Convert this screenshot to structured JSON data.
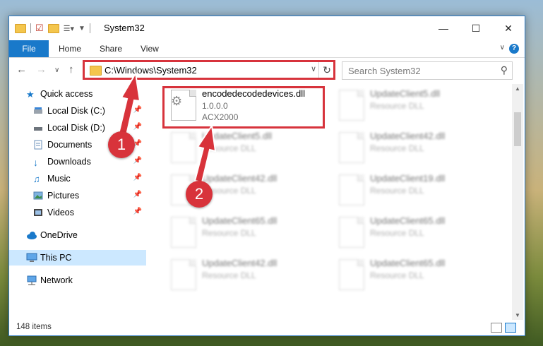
{
  "window": {
    "title": "System32"
  },
  "ribbon": {
    "tabs": [
      "File",
      "Home",
      "Share",
      "View"
    ],
    "help": "?"
  },
  "nav": {
    "address_path": "C:\\Windows\\System32",
    "search_placeholder": "Search System32"
  },
  "sidebar": {
    "items": [
      {
        "label": "Quick access",
        "icon": "star-icon",
        "pinned": false
      },
      {
        "label": "Local Disk (C:)",
        "icon": "drive-icon",
        "pinned": true
      },
      {
        "label": "Local Disk (D:)",
        "icon": "drive-icon",
        "pinned": true
      },
      {
        "label": "Documents",
        "icon": "documents-icon",
        "pinned": true
      },
      {
        "label": "Downloads",
        "icon": "download-icon",
        "pinned": true
      },
      {
        "label": "Music",
        "icon": "music-icon",
        "pinned": true
      },
      {
        "label": "Pictures",
        "icon": "pictures-icon",
        "pinned": true
      },
      {
        "label": "Videos",
        "icon": "videos-icon",
        "pinned": true
      },
      {
        "label": "OneDrive",
        "icon": "cloud-icon",
        "pinned": false
      },
      {
        "label": "This PC",
        "icon": "computer-icon",
        "pinned": false,
        "selected": true
      },
      {
        "label": "Network",
        "icon": "network-icon",
        "pinned": false
      }
    ]
  },
  "files": [
    {
      "name": "encodedecodedevices.dll",
      "line2": "1.0.0.0",
      "line3": "ACX2000",
      "blurred": false
    },
    {
      "name": "UpdateClient5.dll",
      "line2": "Resource DLL",
      "blurred": true
    },
    {
      "name": "UpdateClient5.dll",
      "line2": "Resource DLL",
      "blurred": true
    },
    {
      "name": "UpdateClient42.dll",
      "line2": "Resource DLL",
      "blurred": true
    },
    {
      "name": "UpdateClient42.dll",
      "line2": "Resource DLL",
      "blurred": true
    },
    {
      "name": "UpdateClient19.dll",
      "line2": "Resource DLL",
      "blurred": true
    },
    {
      "name": "UpdateClient65.dll",
      "line2": "Resource DLL",
      "blurred": true
    },
    {
      "name": "UpdateClient65.dll",
      "line2": "Resource DLL",
      "blurred": true
    },
    {
      "name": "UpdateClient42.dll",
      "line2": "Resource DLL",
      "blurred": true
    },
    {
      "name": "UpdateClient65.dll",
      "line2": "Resource DLL",
      "blurred": true
    }
  ],
  "status": {
    "item_count": "148 items"
  },
  "callouts": [
    "1",
    "2"
  ],
  "colors": {
    "accent": "#1979ca",
    "highlight": "#d7333c",
    "selection": "#cce8ff"
  }
}
